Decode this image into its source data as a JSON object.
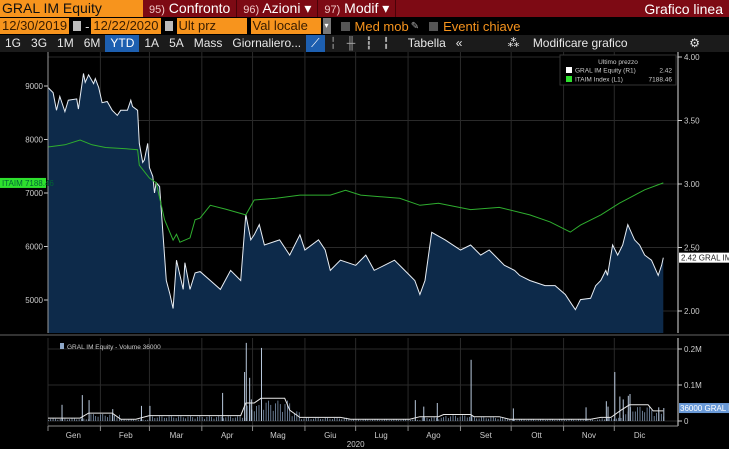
{
  "header": {
    "ticker": "GRAL IM Equity",
    "buttons": [
      {
        "num": "95)",
        "label": "Confronto"
      },
      {
        "num": "96)",
        "label": "Azioni ▾"
      },
      {
        "num": "97)",
        "label": "Modif ▾"
      }
    ],
    "chart_type": "Grafico linea"
  },
  "controls": {
    "start_date": "12/30/2019",
    "sep": "-",
    "end_date": "12/22/2020",
    "field": "Ult prz",
    "currency": "Val locale",
    "moving_avg": "Med mob",
    "key_events": "Eventi chiave"
  },
  "toolbar": {
    "periods": [
      "1G",
      "3G",
      "1M",
      "6M",
      "YTD",
      "1A",
      "5A",
      "Mass"
    ],
    "selected": "YTD",
    "frequency": "Giornaliero...",
    "table": "Tabella",
    "collapse": "«",
    "edit": "Modificare grafico"
  },
  "colors": {
    "accent": "#f7941d",
    "header_bg": "#7d0a14",
    "price": "#e8eef5",
    "index": "#2fae2f",
    "fill": "#0d2a4a"
  },
  "legend": {
    "title": "Ultimo prezzo",
    "items": [
      {
        "name": "GRAL IM Equity  (R1)",
        "value": "2.42"
      },
      {
        "name": "ITAIM Index  (L1)",
        "value": "7188.46"
      }
    ]
  },
  "chart_data": [
    {
      "type": "area",
      "title": "",
      "x_unit": "day of 2020",
      "left_axis": {
        "ticks": [
          "9000",
          "8000",
          "7000",
          "6000",
          "5000"
        ],
        "tick_values": [
          9000,
          8000,
          7000,
          6000,
          5000
        ],
        "tag": "ITAIM 7188.46"
      },
      "right_axis": {
        "ticks": [
          "4.00",
          "3.50",
          "3.00",
          "2.50",
          "2.00"
        ],
        "tick_values": [
          4,
          3.5,
          3,
          2.5,
          2
        ],
        "tag": "2.42 GRAL IM"
      },
      "series": [
        {
          "name": "GRAL IM Equity",
          "axis": "right",
          "points": [
            [
              0,
              3.76
            ],
            [
              3,
              3.72
            ],
            [
              5,
              3.58
            ],
            [
              7,
              3.69
            ],
            [
              10,
              3.57
            ],
            [
              12,
              3.66
            ],
            [
              17,
              3.67
            ],
            [
              18,
              3.59
            ],
            [
              21,
              3.87
            ],
            [
              22,
              3.8
            ],
            [
              24,
              3.86
            ],
            [
              27,
              3.79
            ],
            [
              28,
              3.83
            ],
            [
              30,
              3.76
            ],
            [
              32,
              3.64
            ],
            [
              35,
              3.65
            ],
            [
              38,
              3.58
            ],
            [
              41,
              3.54
            ],
            [
              43,
              3.58
            ],
            [
              47,
              3.58
            ],
            [
              49,
              3.66
            ],
            [
              50,
              3.61
            ],
            [
              53,
              3.58
            ],
            [
              54,
              3.32
            ],
            [
              56,
              3.17
            ],
            [
              57,
              3.19
            ],
            [
              59,
              3.32
            ],
            [
              60,
              3.13
            ],
            [
              62,
              3.06
            ],
            [
              63,
              2.93
            ],
            [
              64,
              3.01
            ],
            [
              66,
              2.98
            ],
            [
              70,
              2.24
            ],
            [
              72,
              2.14
            ],
            [
              74,
              2.02
            ],
            [
              76,
              2.4
            ],
            [
              80,
              2.17
            ],
            [
              81,
              2.38
            ],
            [
              84,
              2.17
            ],
            [
              87,
              2.3
            ],
            [
              90,
              2.31
            ],
            [
              96,
              2.24
            ],
            [
              102,
              2.17
            ],
            [
              108,
              2.32
            ],
            [
              114,
              2.24
            ],
            [
              117,
              2.76
            ],
            [
              120,
              2.56
            ],
            [
              122,
              2.6
            ],
            [
              125,
              2.68
            ],
            [
              128,
              2.52
            ],
            [
              137,
              2.56
            ],
            [
              143,
              2.44
            ],
            [
              149,
              2.6
            ],
            [
              152,
              2.48
            ],
            [
              160,
              2.56
            ],
            [
              164,
              2.48
            ],
            [
              167,
              2.32
            ],
            [
              173,
              2.4
            ],
            [
              182,
              2.36
            ],
            [
              188,
              2.44
            ],
            [
              193,
              2.32
            ],
            [
              199,
              2.36
            ],
            [
              205,
              2.4
            ],
            [
              211,
              2.32
            ],
            [
              217,
              2.24
            ],
            [
              220,
              2.13
            ],
            [
              223,
              2.24
            ],
            [
              227,
              2.62
            ],
            [
              235,
              2.56
            ],
            [
              244,
              2.48
            ],
            [
              250,
              2.52
            ],
            [
              256,
              2.44
            ],
            [
              261,
              2.48
            ],
            [
              270,
              2.36
            ],
            [
              276,
              2.32
            ],
            [
              279,
              2.28
            ],
            [
              285,
              2.24
            ],
            [
              294,
              2.2
            ],
            [
              300,
              2.2
            ],
            [
              306,
              2.13
            ],
            [
              310,
              2.05
            ],
            [
              312,
              2.01
            ],
            [
              315,
              2.09
            ],
            [
              321,
              2.1
            ],
            [
              324,
              2.2
            ],
            [
              327,
              2.24
            ],
            [
              330,
              2.32
            ],
            [
              331,
              2.28
            ],
            [
              334,
              2.52
            ],
            [
              337,
              2.44
            ],
            [
              340,
              2.52
            ],
            [
              343,
              2.68
            ],
            [
              347,
              2.56
            ],
            [
              350,
              2.52
            ],
            [
              353,
              2.44
            ],
            [
              357,
              2.4
            ],
            [
              361,
              2.28
            ],
            [
              363,
              2.36
            ],
            [
              364,
              2.42
            ]
          ]
        },
        {
          "name": "ITAIM Index",
          "axis": "left",
          "points": [
            [
              0,
              7860
            ],
            [
              10,
              7900
            ],
            [
              19,
              7990
            ],
            [
              26,
              7900
            ],
            [
              34,
              7850
            ],
            [
              45,
              7830
            ],
            [
              53,
              7810
            ],
            [
              54,
              7520
            ],
            [
              60,
              7280
            ],
            [
              64,
              7190
            ],
            [
              69,
              6500
            ],
            [
              74,
              6120
            ],
            [
              76,
              6230
            ],
            [
              78,
              6080
            ],
            [
              84,
              6160
            ],
            [
              87,
              6500
            ],
            [
              90,
              6530
            ],
            [
              96,
              6770
            ],
            [
              105,
              6700
            ],
            [
              117,
              6590
            ],
            [
              122,
              6870
            ],
            [
              135,
              6900
            ],
            [
              149,
              6960
            ],
            [
              167,
              6960
            ],
            [
              176,
              7050
            ],
            [
              185,
              6960
            ],
            [
              208,
              6900
            ],
            [
              220,
              6770
            ],
            [
              231,
              6810
            ],
            [
              250,
              6690
            ],
            [
              267,
              6730
            ],
            [
              285,
              6590
            ],
            [
              297,
              6460
            ],
            [
              309,
              6270
            ],
            [
              315,
              6400
            ],
            [
              327,
              6590
            ],
            [
              338,
              6810
            ],
            [
              353,
              7060
            ],
            [
              364,
              7188.46
            ]
          ]
        }
      ]
    },
    {
      "type": "bar",
      "title": "GRAL IM Equity - Volume 36000",
      "ticks": [
        "0.2M",
        "0.1M",
        "0"
      ],
      "tick_values": [
        200,
        100,
        0
      ],
      "unit": "thousand shares",
      "tag": "36000 GRAL IM",
      "x_ticks": [
        "Gen",
        "Feb",
        "Mar",
        "Apr",
        "Mag",
        "Giu",
        "Lug",
        "Ago",
        "Set",
        "Ott",
        "Nov",
        "Dic"
      ],
      "xlabel": "2020",
      "spikes": [
        [
          8,
          45
        ],
        [
          20,
          72
        ],
        [
          24,
          58
        ],
        [
          38,
          33
        ],
        [
          55,
          42
        ],
        [
          60,
          42
        ],
        [
          103,
          78
        ],
        [
          116,
          136
        ],
        [
          117,
          217
        ],
        [
          119,
          120
        ],
        [
          120,
          60
        ],
        [
          126,
          203
        ],
        [
          217,
          58
        ],
        [
          222,
          40
        ],
        [
          230,
          50
        ],
        [
          250,
          170
        ],
        [
          275,
          35
        ],
        [
          318,
          38
        ],
        [
          330,
          55
        ],
        [
          331,
          40
        ],
        [
          335,
          136
        ],
        [
          338,
          68
        ],
        [
          340,
          60
        ],
        [
          343,
          70
        ],
        [
          344,
          75
        ],
        [
          361,
          38
        ],
        [
          364,
          36
        ]
      ],
      "moving_average": [
        [
          0,
          8
        ],
        [
          19,
          8
        ],
        [
          24,
          22
        ],
        [
          38,
          22
        ],
        [
          43,
          5
        ],
        [
          52,
          5
        ],
        [
          60,
          15
        ],
        [
          114,
          15
        ],
        [
          117,
          50
        ],
        [
          122,
          50
        ],
        [
          126,
          63
        ],
        [
          140,
          63
        ],
        [
          143,
          30
        ],
        [
          149,
          10
        ],
        [
          173,
          10
        ],
        [
          179,
          5
        ],
        [
          214,
          5
        ],
        [
          220,
          12
        ],
        [
          231,
          12
        ],
        [
          234,
          18
        ],
        [
          250,
          18
        ],
        [
          252,
          12
        ],
        [
          267,
          12
        ],
        [
          273,
          5
        ],
        [
          321,
          5
        ],
        [
          327,
          10
        ],
        [
          333,
          10
        ],
        [
          339,
          30
        ],
        [
          344,
          45
        ],
        [
          355,
          45
        ],
        [
          358,
          28
        ],
        [
          364,
          28
        ]
      ]
    }
  ]
}
